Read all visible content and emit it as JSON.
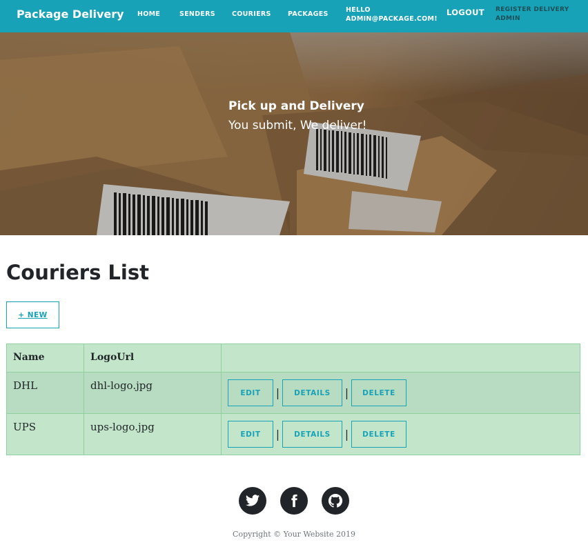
{
  "navbar": {
    "brand": "Package Delivery",
    "links": {
      "home": "HOME",
      "senders": "SENDERS",
      "couriers": "COURIERS",
      "packages": "PACKAGES",
      "hello_line1": "HELLO",
      "hello_line2": "ADMIN@PACKAGE.COM!",
      "logout": "LOGOUT",
      "register_line1": "REGISTER DELIVERY",
      "register_line2": "ADMIN"
    },
    "color": "#17a2b8"
  },
  "hero": {
    "title": "Pick up and Delivery",
    "subtitle": "You submit, We deliver!"
  },
  "main": {
    "title": "Couriers List",
    "new_button": "+ NEW",
    "table": {
      "headers": [
        "Name",
        "LogoUrl",
        ""
      ],
      "rows": [
        {
          "name": "DHL",
          "logo_url": "dhl-logo.jpg"
        },
        {
          "name": "UPS",
          "logo_url": "ups-logo.jpg"
        }
      ],
      "actions": {
        "edit": "EDIT",
        "details": "DETAILS",
        "delete": "DELETE",
        "separator": "|"
      },
      "row_color": "#c3e6cb"
    }
  },
  "footer": {
    "social_icons": [
      "twitter-icon",
      "facebook-icon",
      "github-icon"
    ],
    "copyright": "Copyright © Your Website 2019"
  }
}
